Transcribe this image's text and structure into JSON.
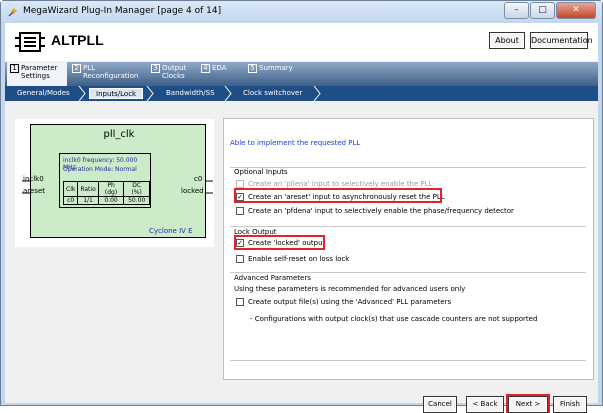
{
  "window": {
    "title": "MegaWizard Plug-In Manager [page 4 of 14]",
    "minimize_label": "–",
    "maximize_label": "□",
    "close_label": "✕"
  },
  "header": {
    "app_name": "ALTPLL",
    "about_label": "About",
    "documentation_label": "Documentation"
  },
  "tabs": [
    {
      "num": "1",
      "label": "Parameter\nSettings",
      "active": true
    },
    {
      "num": "2",
      "label": "PLL\nReconfiguration",
      "active": false
    },
    {
      "num": "3",
      "label": "Output\nClocks",
      "active": false
    },
    {
      "num": "4",
      "label": "EDA",
      "active": false
    },
    {
      "num": "5",
      "label": "Summary",
      "active": false
    }
  ],
  "subtabs": [
    {
      "label": "General/Modes",
      "active": false
    },
    {
      "label": "Inputs/Lock",
      "active": true
    },
    {
      "label": "Bandwidth/SS",
      "active": false
    },
    {
      "label": "Clock switchover",
      "active": false
    }
  ],
  "diagram": {
    "block_name": "pll_clk",
    "inputs": [
      "inclk0",
      "areset"
    ],
    "outputs": [
      "c0",
      "locked"
    ],
    "freq_line": "inclk0 frequency: 50.000 MHz",
    "mode_line": "Operation Mode: Normal",
    "table_headers": [
      "Clk",
      "Ratio",
      "Ph (dg)",
      "DC (%)"
    ],
    "table_row": [
      "c0",
      "1/1",
      "0.00",
      "50.00"
    ],
    "device": "Cyclone IV E"
  },
  "main": {
    "status_message": "Able to implement the requested PLL",
    "optional_inputs_title": "Optional Inputs",
    "opt_pllena": "Create an 'pllena' input to selectively enable the PLL",
    "opt_areset": "Create an 'areset' input to asynchronously reset the PLL",
    "opt_pfdena": "Create an 'pfdena' input to selectively enable the phase/frequency detector",
    "lock_output_title": "Lock Output",
    "opt_locked": "Create 'locked' output",
    "opt_self_reset": "Enable self-reset on loss lock",
    "advanced_title": "Advanced Parameters",
    "advanced_note": "Using these parameters is recommended for advanced users only",
    "opt_output_files": "Create output file(s) using the 'Advanced' PLL parameters",
    "cascade_note": "- Configurations with output clock(s) that use cascade counters are not supported",
    "checked_mark": "✓"
  },
  "footer": {
    "cancel_label": "Cancel",
    "back_label": "< Back",
    "next_label": "Next >",
    "finish_label": "Finish"
  },
  "colors": {
    "highlight_border": "#e8202a",
    "tab_strip": "#3f5f87",
    "status_text": "#1b3fd0",
    "diagram_fill": "#ccebc9"
  }
}
